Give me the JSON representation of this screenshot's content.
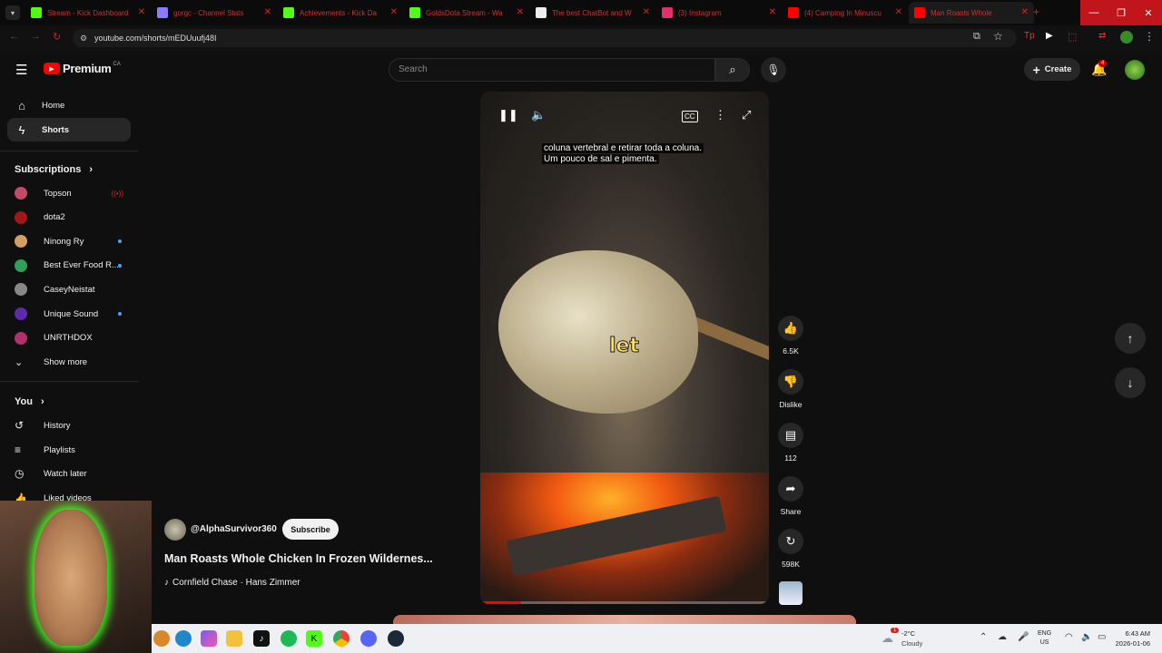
{
  "browser": {
    "tabs": [
      {
        "label": "Stream - Kick Dashboard",
        "color": "#53fc18"
      },
      {
        "label": "gorgc - Channel Stats",
        "color": "#8a7cff"
      },
      {
        "label": "Achievements - Kick Da",
        "color": "#53fc18"
      },
      {
        "label": "GoldsDota Stream - Wa",
        "color": "#53fc18"
      },
      {
        "label": "The best ChatBot and W",
        "color": "#eeeeee"
      },
      {
        "label": "(3) Instagram",
        "color": "#e1306c"
      },
      {
        "label": "(4) Camping In Minuscu",
        "color": "#ff0000"
      },
      {
        "label": "Man Roasts Whole",
        "color": "#ff0000"
      }
    ],
    "url": "youtube.com/shorts/mEDUuufj48I"
  },
  "header": {
    "logo_text": "Premium",
    "logo_region": "CA",
    "search_placeholder": "Search",
    "create_label": "Create",
    "notification_count": "4"
  },
  "sidebar": {
    "main": [
      {
        "label": "Home",
        "icon": "home-icon"
      },
      {
        "label": "Shorts",
        "icon": "shorts-icon",
        "active": true
      }
    ],
    "subscriptions_title": "Subscriptions",
    "subscriptions": [
      {
        "label": "Topson",
        "color": "#c44a6a",
        "live": true
      },
      {
        "label": "dota2",
        "color": "#a01818"
      },
      {
        "label": "Ninong Ry",
        "color": "#d4a060",
        "dot": true
      },
      {
        "label": "Best Ever Food R...",
        "color": "#2f9f5a",
        "dot": true
      },
      {
        "label": "CaseyNeistat",
        "color": "#888888"
      },
      {
        "label": "Unique Sound",
        "color": "#5a2aa8",
        "dot": true
      },
      {
        "label": "UNRTHDOX",
        "color": "#b0306a"
      }
    ],
    "show_more": "Show more",
    "you_title": "You",
    "you_items": [
      {
        "label": "History"
      },
      {
        "label": "Playlists"
      },
      {
        "label": "Watch later"
      },
      {
        "label": "Liked videos"
      }
    ]
  },
  "video": {
    "caption_line1": "coluna vertebral e retirar toda a coluna.",
    "caption_line2": "Um pouco de sal e pimenta.",
    "overlay_word": "let",
    "progress": 0.14,
    "channel": "@AlphaSurvivor360",
    "subscribe_label": "Subscribe",
    "title": "Man Roasts Whole Chicken In Frozen Wildernes...",
    "music": "Cornfield Chase · Hans Zimmer"
  },
  "actions": {
    "likes": "6.5K",
    "dislike": "Dislike",
    "comments": "112",
    "share": "Share",
    "remix": "598K"
  },
  "taskbar": {
    "weather_temp": "-2°C",
    "weather_desc": "Cloudy",
    "weather_badge": "1",
    "lang1": "ENG",
    "lang2": "US",
    "time": "6:43 AM",
    "date": "2026-01-06"
  }
}
